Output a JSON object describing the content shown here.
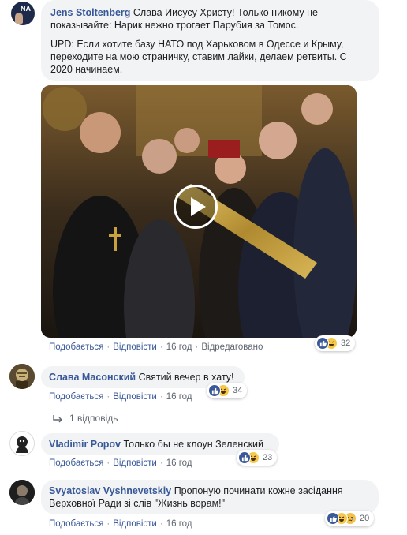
{
  "comments": [
    {
      "author": "Jens Stoltenberg",
      "text_line1": "Слава Иисусу Христу! Только никому не",
      "text_line2": "показывайте: Нарик нежно трогает Парубия за Томос.",
      "upd_line1": "UPD: Если хотите базу НАТО под Харьковом в Одессе и Крыму,",
      "upd_line2": "переходите на мою страничку, ставим лайки, делаем ретвиты. С",
      "upd_line3": "2020 начинаем.",
      "avatar_text": "NA",
      "actions": {
        "like": "Подобається",
        "reply": "Відповісти",
        "time": "16 год",
        "edited": "Відредаговано"
      },
      "reaction_count": "32"
    },
    {
      "author": "Слава Масонский",
      "text": "Святий вечер в хату!",
      "actions": {
        "like": "Подобається",
        "reply": "Відповісти",
        "time": "16 год"
      },
      "reaction_count": "34",
      "replies_link": "1 відповідь"
    },
    {
      "author": "Vladimir Popov",
      "text": "Только бы не клоун Зеленский",
      "actions": {
        "like": "Подобається",
        "reply": "Відповісти",
        "time": "16 год"
      },
      "reaction_count": "23"
    },
    {
      "author": "Svyatoslav Vyshnevetskiy",
      "text_line1": "Пропоную починати кожне засідання",
      "text_line2": "Верховної Ради зі слів \"Жизнь ворам!\"",
      "actions": {
        "like": "Подобається",
        "reply": "Відповісти",
        "time": "16 год"
      },
      "reaction_count": "20"
    }
  ],
  "colors": {
    "link": "#385898",
    "bubble": "#f2f3f5",
    "like_blue": "#3b5998",
    "meta": "#606770"
  },
  "icons": {
    "play": "play-icon",
    "like": "like-reaction-icon",
    "haha": "haha-reaction-icon",
    "sad": "sad-reaction-icon",
    "reply_arrow": "reply-arrow-icon"
  }
}
